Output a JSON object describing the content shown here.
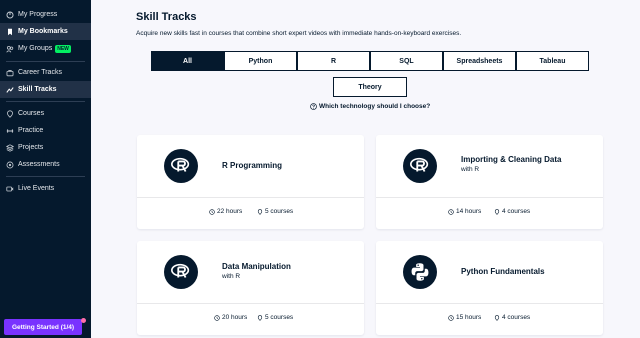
{
  "sidebar": {
    "items": [
      {
        "label": "My Progress",
        "icon": "progress-icon"
      },
      {
        "label": "My Bookmarks",
        "icon": "bookmark-icon",
        "active": true
      },
      {
        "label": "My Groups",
        "icon": "groups-icon",
        "badge": "NEW"
      },
      {
        "label": "Career Tracks",
        "icon": "career-tracks-icon"
      },
      {
        "label": "Skill Tracks",
        "icon": "skill-tracks-icon",
        "active": true
      },
      {
        "label": "Courses",
        "icon": "courses-icon"
      },
      {
        "label": "Practice",
        "icon": "practice-icon"
      },
      {
        "label": "Projects",
        "icon": "projects-icon"
      },
      {
        "label": "Assessments",
        "icon": "assessments-icon"
      },
      {
        "label": "Live Events",
        "icon": "live-events-icon"
      }
    ],
    "getting_started": "Getting Started (1/4)"
  },
  "main": {
    "title": "Skill Tracks",
    "description": "Acquire new skills fast in courses that combine short expert videos with immediate hands-on-keyboard exercises.",
    "tabs": [
      "All",
      "Python",
      "R",
      "SQL",
      "Spreadsheets",
      "Tableau",
      "Theory"
    ],
    "active_tab": "All",
    "help_link": "Which technology should I choose?",
    "cards": [
      {
        "title": "R Programming",
        "subtitle": "",
        "logo": "r-logo-icon",
        "hours": "22 hours",
        "courses": "5 courses"
      },
      {
        "title": "Importing & Cleaning Data",
        "subtitle": "with R",
        "logo": "r-logo-icon",
        "hours": "14 hours",
        "courses": "4 courses"
      },
      {
        "title": "Data Manipulation",
        "subtitle": "with R",
        "logo": "r-logo-icon",
        "hours": "20 hours",
        "courses": "5 courses"
      },
      {
        "title": "Python Fundamentals",
        "subtitle": "",
        "logo": "python-logo-icon",
        "hours": "15 hours",
        "courses": "4 courses"
      }
    ]
  },
  "colors": {
    "sidebar_bg": "#05192d",
    "accent_green": "#03ef62",
    "accent_purple": "#7933ff",
    "page_bg": "#f7f7fc"
  }
}
